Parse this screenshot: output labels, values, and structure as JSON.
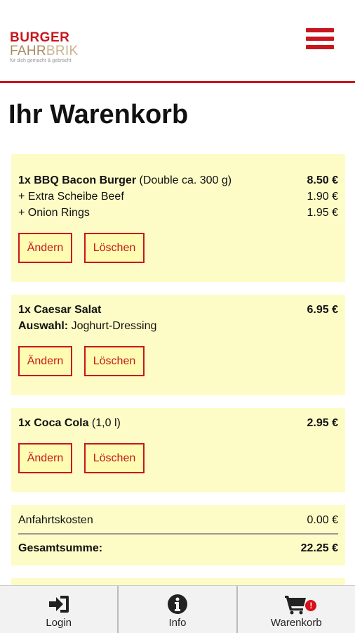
{
  "brand": {
    "line1": "BURGER",
    "line2_dark": "FAHR",
    "line2_light": "BRIK",
    "tagline": "für dich gemacht & gebracht",
    "primary_color": "#c8161e",
    "card_color": "#fdfcc6"
  },
  "page": {
    "title": "Ihr Warenkorb"
  },
  "cart": {
    "items": [
      {
        "name": "1x BBQ Bacon Burger",
        "detail": " (Double ca. 300 g)",
        "price": "8.50 €",
        "extras": [
          {
            "label": "+ Extra Scheibe Beef",
            "price": "1.90 €"
          },
          {
            "label": "+ Onion Rings",
            "price": "1.95 €"
          }
        ],
        "edit_label": "Ändern",
        "delete_label": "Löschen"
      },
      {
        "name": "1x Caesar Salat",
        "detail": "",
        "price": "6.95 €",
        "choice_label": "Auswahl:",
        "choice_value": " Joghurt-Dressing",
        "edit_label": "Ändern",
        "delete_label": "Löschen"
      },
      {
        "name": "1x Coca Cola",
        "detail": " (1,0 l)",
        "price": "2.95 €",
        "edit_label": "Ändern",
        "delete_label": "Löschen"
      }
    ],
    "summary": {
      "delivery_label": "Anfahrtskosten",
      "delivery_value": "0.00 €",
      "total_label": "Gesamtsumme:",
      "total_value": "22.25 €"
    }
  },
  "tabbar": {
    "tabs": [
      {
        "label": "Login",
        "icon": "login-icon"
      },
      {
        "label": "Info",
        "icon": "info-icon"
      },
      {
        "label": "Warenkorb",
        "icon": "cart-icon",
        "badge": "!"
      }
    ]
  }
}
